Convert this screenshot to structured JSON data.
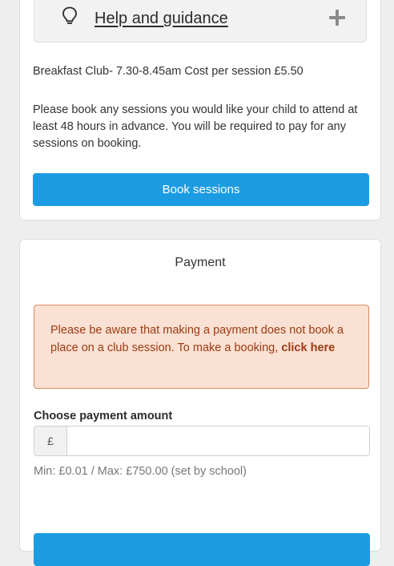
{
  "help": {
    "label": "Help and guidance",
    "bulb_icon": "lightbulb-icon",
    "expand_icon": "plus-icon"
  },
  "club": {
    "info": "Breakfast Club- 7.30-8.45am Cost per session £5.50",
    "note": "Please book any sessions you would like your child to attend at least 48 hours in advance. You will be required to pay for any sessions on booking.",
    "book_button": "Book sessions"
  },
  "payment": {
    "title": "Payment",
    "notice_text": "Please be aware that making a payment does not book a place on a club session. To make a booking, ",
    "notice_link": "click here",
    "amount_label": "Choose payment amount",
    "currency_prefix": "£",
    "amount_value": "",
    "limits": "Min: £0.01 / Max: £750.00 (set by school)"
  },
  "colors": {
    "accent": "#1b9ce2",
    "notice_bg": "#fbe1d3",
    "notice_border": "#d98b5f",
    "notice_text": "#9b3a12"
  }
}
